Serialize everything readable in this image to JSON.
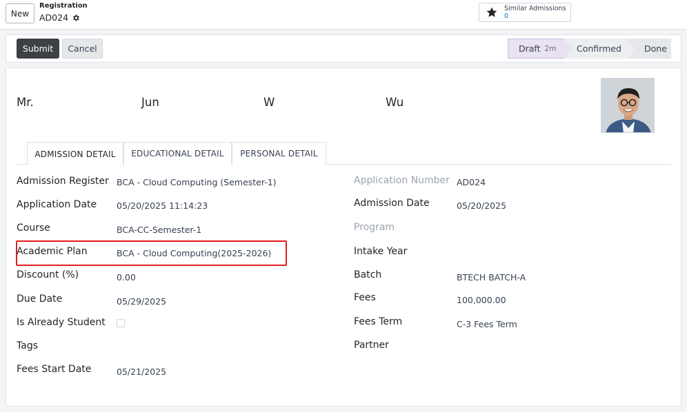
{
  "control_panel": {
    "new_label": "New",
    "breadcrumb_label": "Registration",
    "record_name": "AD024",
    "smart_button": {
      "label": "Similar Admissions",
      "count": "0"
    }
  },
  "actions": {
    "submit_label": "Submit",
    "cancel_label": "Cancel"
  },
  "status": {
    "stages": [
      {
        "label": "Draft",
        "duration": "2m"
      },
      {
        "label": "Confirmed"
      },
      {
        "label": "Done"
      }
    ],
    "current": "Draft"
  },
  "header": {
    "title": "Mr.",
    "first_name": "Jun",
    "middle_name": "W",
    "last_name": "Wu"
  },
  "tabs": [
    {
      "label": "ADMISSION DETAIL"
    },
    {
      "label": "EDUCATIONAL DETAIL"
    },
    {
      "label": "PERSONAL DETAIL"
    }
  ],
  "left_fields": [
    {
      "label": "Admission Register",
      "value": "BCA - Cloud Computing (Semester-1)"
    },
    {
      "label": "Application Date",
      "value": "05/20/2025 11:14:23"
    },
    {
      "label": "Course",
      "value": "BCA-CC-Semester-1"
    },
    {
      "label": "Academic Plan",
      "value": "BCA - Cloud Computing(2025-2026)"
    },
    {
      "label": "Discount (%)",
      "value": "0.00"
    },
    {
      "label": "Due Date",
      "value": "05/29/2025"
    },
    {
      "label": "Is Already Student",
      "value": ""
    },
    {
      "label": "Tags",
      "value": ""
    },
    {
      "label": "Fees Start Date",
      "value": "05/21/2025"
    }
  ],
  "right_fields": [
    {
      "label": "Application Number",
      "value": "AD024"
    },
    {
      "label": "Admission Date",
      "value": "05/20/2025"
    },
    {
      "label": "Program",
      "value": ""
    },
    {
      "label": "Intake Year",
      "value": ""
    },
    {
      "label": "Batch",
      "value": "BTECH BATCH-A"
    },
    {
      "label": "Fees",
      "value": "100,000.00"
    },
    {
      "label": "Fees Term",
      "value": "C-3 Fees Term"
    },
    {
      "label": "Partner",
      "value": ""
    }
  ],
  "is_already_student": false,
  "colors": {
    "highlight": "#e11d1d",
    "primary_button": "#3d4045",
    "active_stage": "#e8e2f2",
    "link": "#0b74c4"
  }
}
